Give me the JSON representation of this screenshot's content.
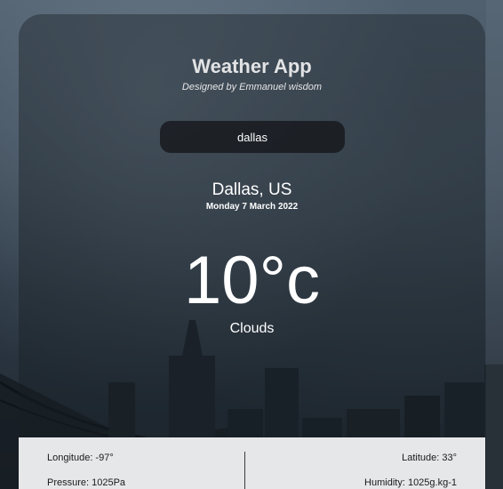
{
  "app": {
    "title": "Weather App",
    "subtitle": "Designed by Emmanuel wisdom"
  },
  "search": {
    "value": "dallas"
  },
  "weather": {
    "location": "Dallas, US",
    "date": "Monday 7 March 2022",
    "temperature": "10°c",
    "condition": "Clouds"
  },
  "details": {
    "longitude": "Longitude: -97°",
    "latitude": "Latitude: 33°",
    "pressure": "Pressure: 1025Pa",
    "humidity": "Humidity: 1025g.kg-1"
  },
  "colors": {
    "card_background": "#191e24",
    "panel_background": "#e6e7e9",
    "text_light": "#ffffff"
  }
}
